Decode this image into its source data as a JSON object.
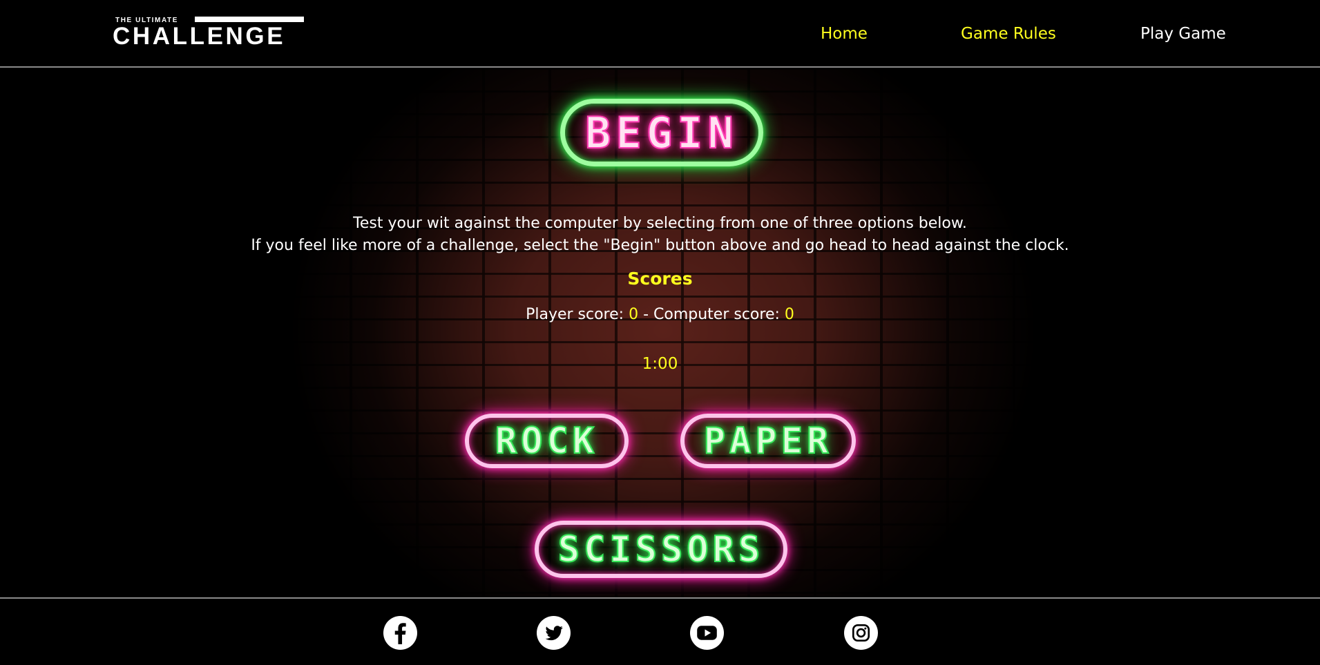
{
  "header": {
    "logo": {
      "small_text": "THE ULTIMATE",
      "big_text": "CHALLENGE"
    },
    "nav": [
      {
        "label": "Home",
        "color": "#ffff1e"
      },
      {
        "label": "Game Rules",
        "color": "#ffff1e"
      },
      {
        "label": "Play Game",
        "color": "#ffffff"
      }
    ]
  },
  "main": {
    "begin_button": "BEGIN",
    "description": {
      "line1": "Test your wit against the computer by selecting from one of three options below.",
      "line2": "If you feel like more of a challenge, select the \"Begin\" button above and go head to head against the clock."
    },
    "scores": {
      "title": "Scores",
      "player_label": "Player score:",
      "player_score": "0",
      "separator": "-",
      "computer_label": "Computer score:",
      "computer_score": "0"
    },
    "timer": "1:00",
    "choices": {
      "rock": "ROCK",
      "paper": "PAPER",
      "scissors": "SCISSORS"
    }
  },
  "footer": {
    "social_icons": [
      "facebook-icon",
      "twitter-icon",
      "youtube-icon",
      "instagram-icon"
    ]
  },
  "colors": {
    "accent_yellow": "#ffff1e",
    "neon_green": "#3dff58",
    "neon_pink": "#ff34b6",
    "background": "#000000"
  }
}
